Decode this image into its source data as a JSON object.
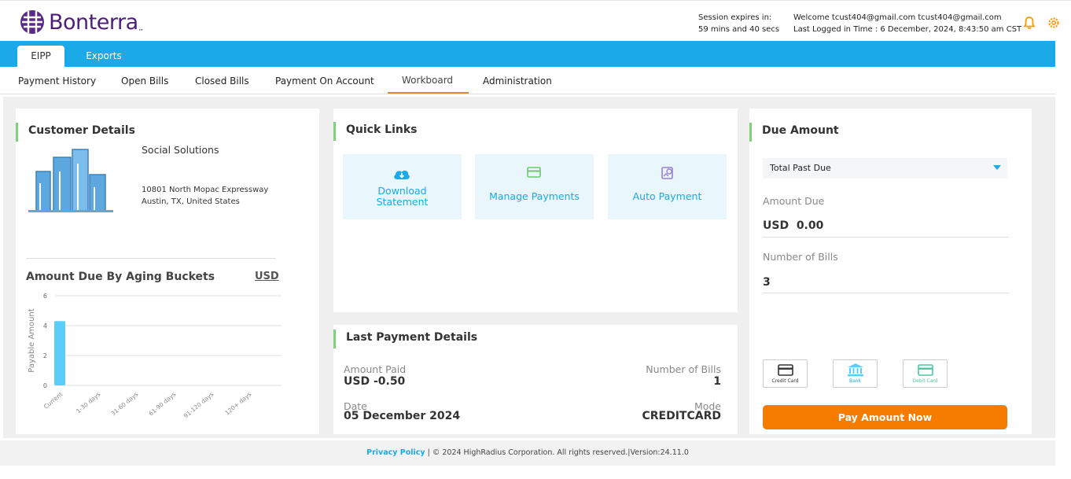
{
  "brand": {
    "name": "Bonterra",
    "trademark": "™"
  },
  "header": {
    "session_label": "Session expires in:",
    "session_value": "59 mins and 40 secs",
    "welcome": "Welcome tcust404@gmail.com tcust404@gmail.com",
    "last_login": "Last Logged in Time : 6 December, 2024, 8:43:50 am CST",
    "icons": [
      "bell-icon",
      "gear-icon"
    ],
    "accent_color": "#f39c12"
  },
  "tabs": [
    {
      "label": "EIPP",
      "active": true
    },
    {
      "label": "Exports",
      "active": false
    }
  ],
  "subnav": [
    {
      "label": "Payment History"
    },
    {
      "label": "Open Bills"
    },
    {
      "label": "Closed Bills"
    },
    {
      "label": "Payment On Account"
    },
    {
      "label": "Workboard",
      "active": true
    },
    {
      "label": "Administration"
    }
  ],
  "customer": {
    "title": "Customer Details",
    "name": "Social Solutions",
    "address_line1": "10801 North Mopac Expressway",
    "address_line2": "Austin, TX, United States",
    "icon": "buildings-icon"
  },
  "aging": {
    "title": "Amount Due By Aging Buckets",
    "currency": "USD"
  },
  "chart_data": {
    "type": "bar",
    "categories": [
      "Current",
      "1-30 days",
      "31-60 days",
      "61-90 days",
      "91-120 days",
      "120+ days"
    ],
    "values": [
      4.3,
      0,
      0,
      0,
      0,
      0
    ],
    "ylabel": "Payable Amount",
    "xlabel": "",
    "ylim": [
      0,
      6
    ],
    "yticks": [
      0,
      2,
      4,
      6
    ],
    "grid": true,
    "color": "#5bcdf9"
  },
  "quick_links": {
    "title": "Quick Links",
    "items": [
      {
        "label": "Download Statement",
        "icon": "cloud-download-icon"
      },
      {
        "label": "Manage Payments",
        "icon": "card-icon"
      },
      {
        "label": "Auto Payment",
        "icon": "auto-payment-icon"
      }
    ]
  },
  "last_payment": {
    "title": "Last Payment Details",
    "amount_paid_label": "Amount Paid",
    "amount_paid_value": "USD -0.50",
    "bills_label": "Number of Bills",
    "bills_value": "1",
    "date_label": "Date",
    "date_value": "05 December 2024",
    "mode_label": "Mode",
    "mode_value": "CREDITCARD"
  },
  "due": {
    "title": "Due Amount",
    "select_value": "Total Past Due",
    "amount_due_label": "Amount Due",
    "amount_due_value": "USD  0.00",
    "bills_label": "Number of Bills",
    "bills_value": "3",
    "methods": [
      {
        "label": "Credit Card",
        "icon": "credit-card-icon"
      },
      {
        "label": "Bank",
        "icon": "bank-icon"
      },
      {
        "label": "Debit Card",
        "icon": "debit-card-icon"
      }
    ],
    "pay_button": "Pay Amount Now",
    "button_color": "#f57c00"
  },
  "footer": {
    "privacy": "Privacy Policy",
    "copyright": " | © 2024 HighRadius Corporation. All rights reserved.|Version:24.11.0"
  }
}
